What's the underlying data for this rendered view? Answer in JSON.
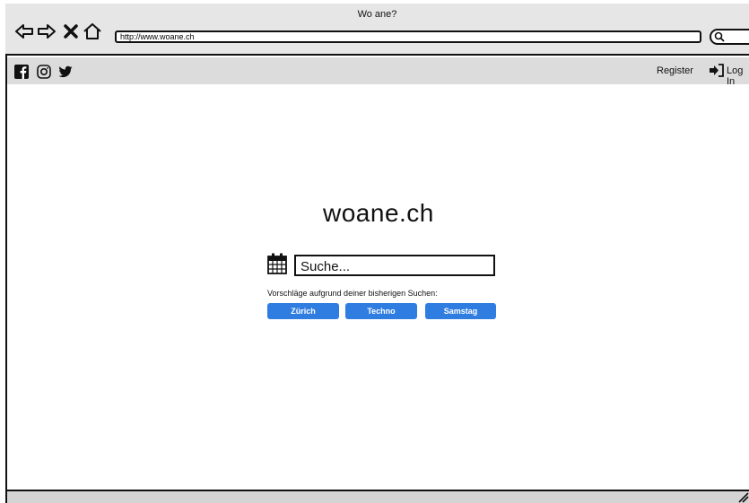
{
  "window": {
    "title": "Wo ane?"
  },
  "browser": {
    "url": "http://www.woane.ch",
    "back_icon": "arrow-left-icon",
    "forward_icon": "arrow-right-icon",
    "stop_icon": "close-icon",
    "home_icon": "home-icon",
    "search_icon": "search-icon"
  },
  "header": {
    "social": [
      "facebook-icon",
      "instagram-icon",
      "twitter-icon"
    ],
    "register_label": "Register",
    "login_label": "Log In"
  },
  "main": {
    "brand": "woane.ch",
    "search_placeholder": "Suche...",
    "suggestions_label": "Vorschläge aufgrund deiner bisherigen Suchen:",
    "suggestions": [
      "Zürich",
      "Techno",
      "Samstag"
    ]
  },
  "colors": {
    "chip": "#2f7de1",
    "topbar": "#dcdcdc",
    "titlebar": "#e6e6e6"
  }
}
